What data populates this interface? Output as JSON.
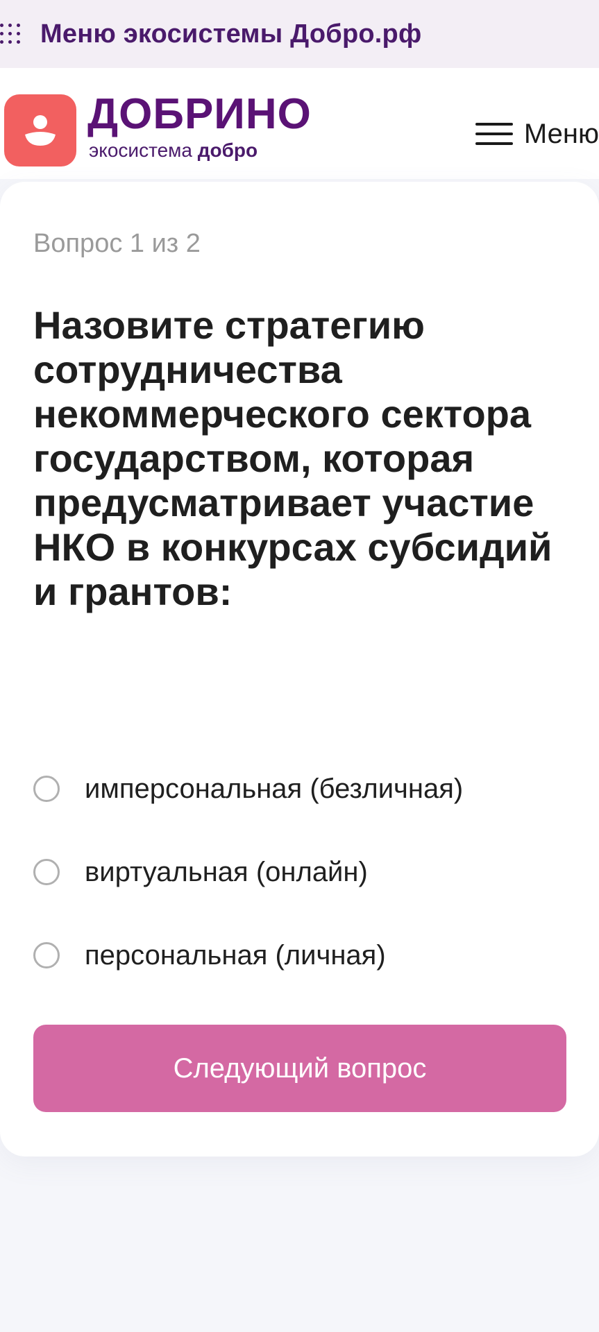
{
  "eco_bar": {
    "title": "Меню экосистемы Добро.рф",
    "icon": "grid-dots-icon"
  },
  "header": {
    "brand_name": "ДОБРИНО",
    "brand_sub_prefix": "экосистема ",
    "brand_sub_bold": "добро",
    "menu_label": "Меню",
    "logo_color": "#f26060",
    "brand_color": "#5a1275"
  },
  "quiz": {
    "counter": "Вопрос 1 из 2",
    "question": "Назовите стратегию сотрудничества некоммерческого сектора государством, которая предусматривает участие НКО в конкурсах субсидий и грантов:",
    "options": [
      {
        "label": "имперсональная (безличная)",
        "selected": false
      },
      {
        "label": "виртуальная (онлайн)",
        "selected": false
      },
      {
        "label": "персональная (личная)",
        "selected": false
      }
    ],
    "next_button": "Следующий вопрос",
    "button_color": "#d469a3"
  }
}
